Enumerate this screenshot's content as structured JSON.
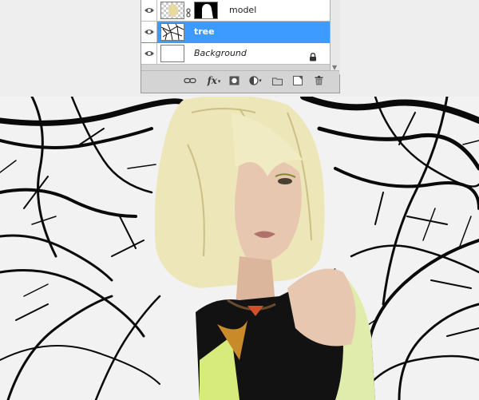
{
  "layers_panel": {
    "layers": [
      {
        "name": "model",
        "visible": true,
        "selected": false,
        "has_mask": true,
        "italic": false
      },
      {
        "name": "tree",
        "visible": true,
        "selected": true,
        "has_mask": false,
        "italic": false
      },
      {
        "name": "Background",
        "visible": true,
        "selected": false,
        "has_mask": false,
        "italic": true,
        "locked": true
      }
    ],
    "footer_icons": [
      "link-icon",
      "fx-icon",
      "mask-icon",
      "adjustment-icon",
      "folder-icon",
      "new-layer-icon",
      "trash-icon"
    ],
    "fx_label": "fx"
  },
  "colors": {
    "selection": "#3d9aff",
    "panel": "#d4d4d4",
    "hair": "#ece6b8",
    "top_fabric": "#d7ea7c"
  }
}
